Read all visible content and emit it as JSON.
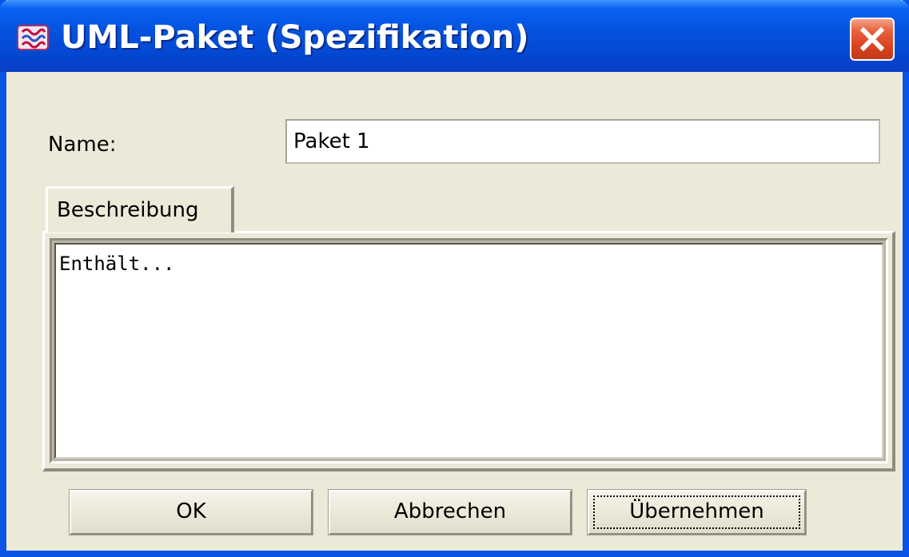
{
  "window": {
    "title": "UML-Paket (Spezifikation)",
    "app_icon": "uml-app-icon",
    "close_icon": "close-x-icon"
  },
  "form": {
    "name_label": "Name:",
    "name_value": "Paket 1"
  },
  "tabs": [
    {
      "label": "Beschreibung",
      "selected": true
    }
  ],
  "description": {
    "text": "Enthält..."
  },
  "buttons": {
    "ok": "OK",
    "cancel": "Abbrechen",
    "apply": "Übernehmen",
    "focused": "apply"
  },
  "colors": {
    "titlebar": "#0553e0",
    "dialog_bg": "#ece9d8",
    "close_button": "#d8421e"
  }
}
